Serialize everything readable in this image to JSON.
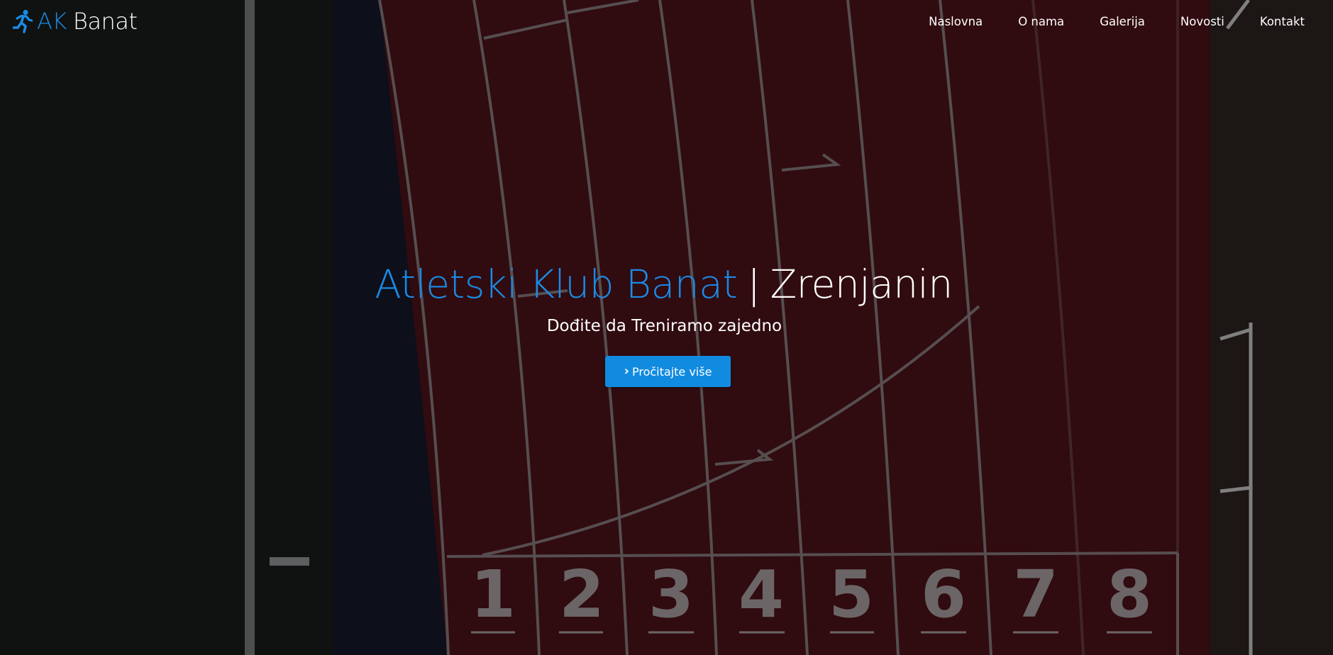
{
  "brand": {
    "icon": "running-person-icon",
    "short": "AK",
    "name": "Banat",
    "accent_color": "#1a8be6"
  },
  "nav": {
    "items": [
      {
        "label": "Naslovna"
      },
      {
        "label": "O nama"
      },
      {
        "label": "Galerija"
      },
      {
        "label": "Novosti"
      },
      {
        "label": "Kontakt"
      }
    ]
  },
  "hero": {
    "title_club": "Atletski Klub Banat",
    "title_separator": "|",
    "title_city": "Zrenjanin",
    "subtitle": "Dođite da Treniramo zajedno",
    "cta_icon": "chevron-right-icon",
    "cta_label": "Pročitajte više",
    "cta_color": "#118be0"
  },
  "track": {
    "lane_numbers": [
      "1",
      "2",
      "3",
      "4",
      "5",
      "6",
      "7",
      "8"
    ],
    "track_color": "#4a1218",
    "field_color": "#181c1a"
  }
}
